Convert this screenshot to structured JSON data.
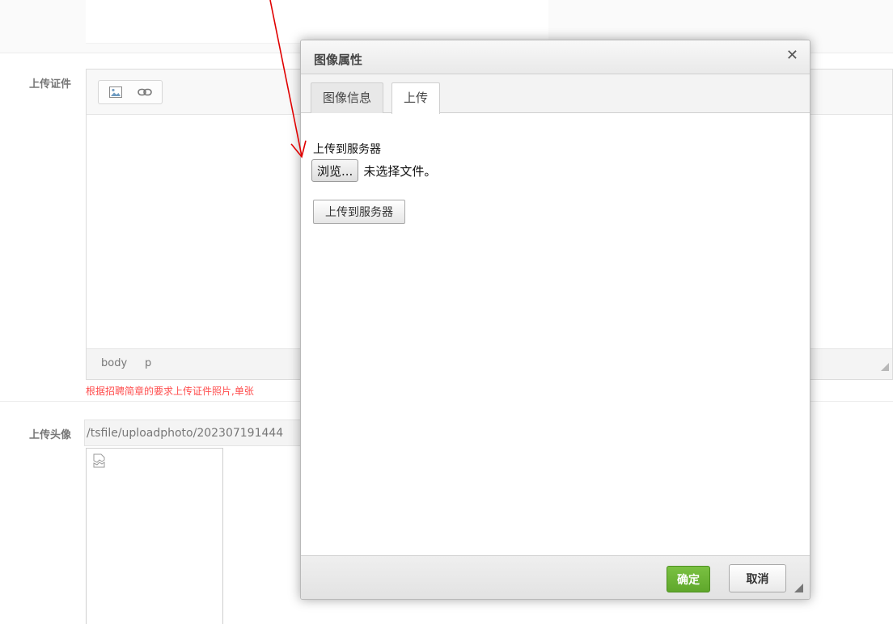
{
  "form": {
    "upload_cert_label": "上传证件",
    "upload_avatar_label": "上传头像",
    "editor_path": [
      "body",
      "p"
    ],
    "hint_text": "根据招聘简章的要求上传证件照片,单张",
    "avatar_path_value": "/tsfile/uploadphoto/202307191444"
  },
  "toolbar": {
    "icons": [
      "image-icon",
      "link-icon"
    ]
  },
  "dialog": {
    "title": "图像属性",
    "close_glyph": "✕",
    "tabs": [
      {
        "label": "图像信息",
        "active": false
      },
      {
        "label": "上传",
        "active": true
      }
    ],
    "upload": {
      "label": "上传到服务器",
      "browse_label": "浏览...",
      "file_status": "未选择文件。",
      "upload_button_label": "上传到服务器"
    },
    "footer": {
      "ok_label": "确定",
      "cancel_label": "取消"
    }
  },
  "colors": {
    "hint": "#ff4d4d",
    "ok_button": "#6cb33a",
    "annotation_arrow": "#e00000"
  }
}
